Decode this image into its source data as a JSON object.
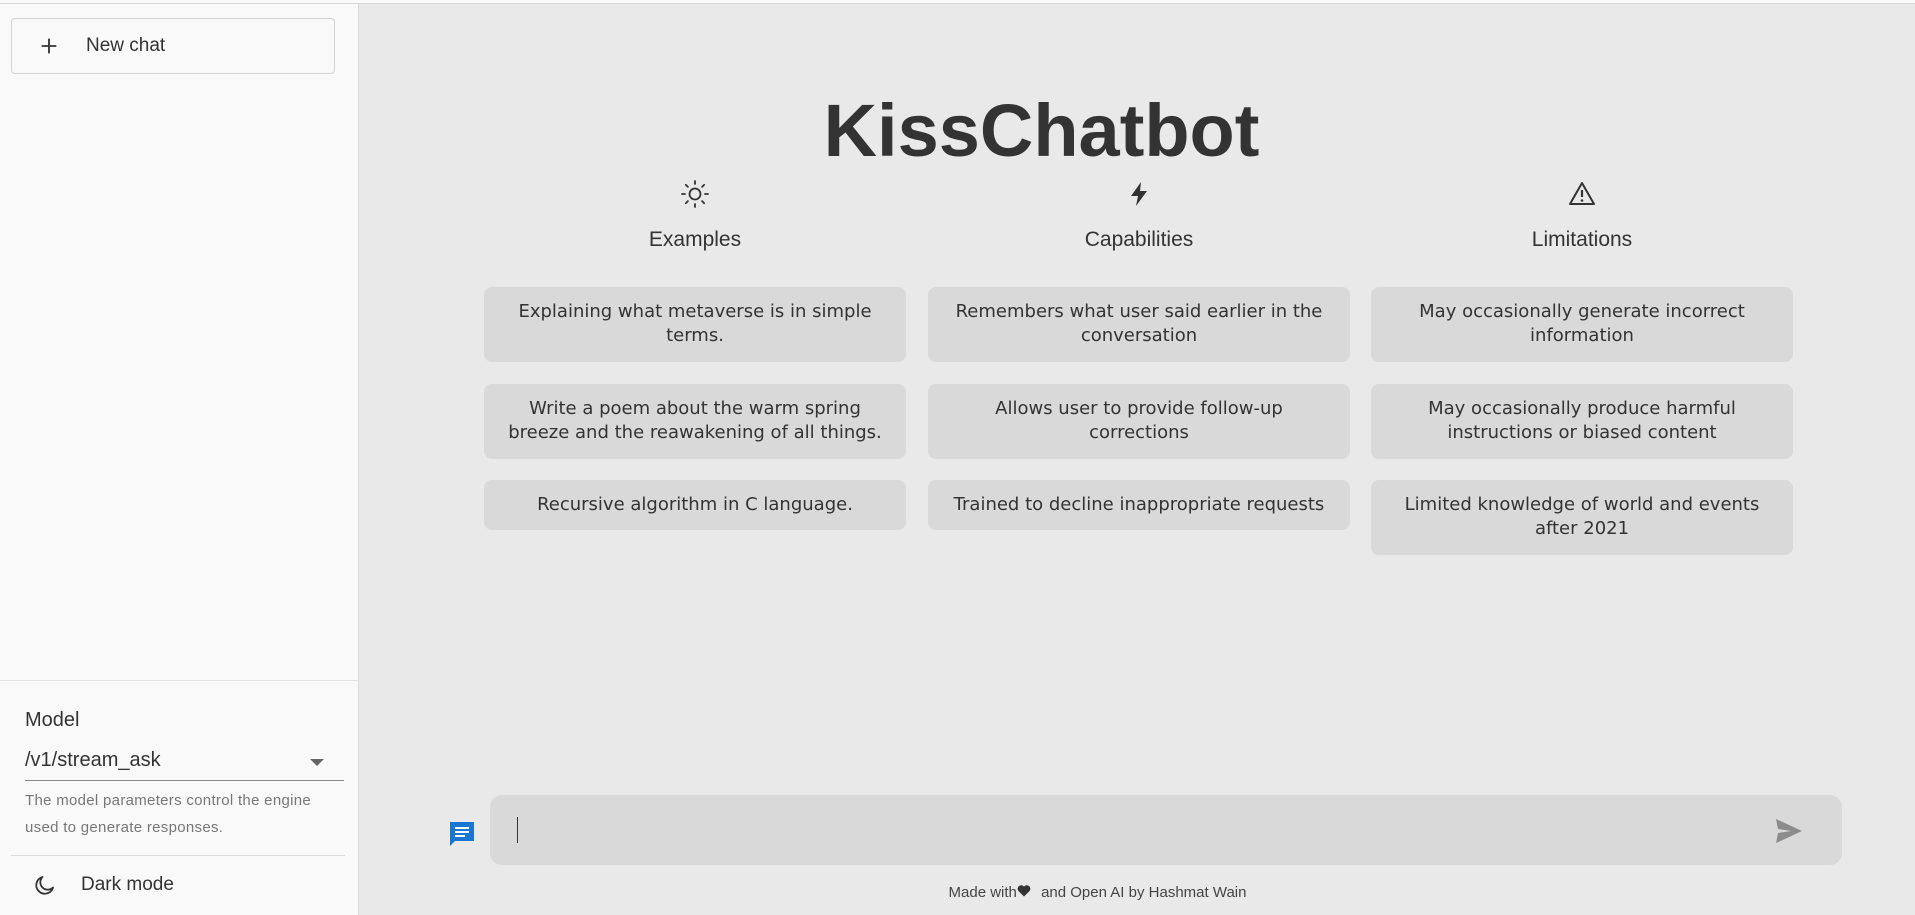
{
  "sidebar": {
    "new_chat_label": "New chat",
    "model_label": "Model",
    "model_value": "/v1/stream_ask",
    "model_help": "The model parameters control the engine used to generate responses.",
    "dark_mode_label": "Dark mode"
  },
  "main": {
    "title": "KissChatbot",
    "columns": [
      {
        "icon": "sun-icon",
        "heading": "Examples",
        "cards": [
          "Explaining what metaverse is in simple terms.",
          "Write a poem about the warm spring breeze and the reawakening of all things.",
          "Recursive algorithm in C language."
        ]
      },
      {
        "icon": "lightning-icon",
        "heading": "Capabilities",
        "cards": [
          "Remembers what user said earlier in the conversation",
          "Allows user to provide follow-up corrections",
          "Trained to decline inappropriate requests"
        ]
      },
      {
        "icon": "warning-icon",
        "heading": "Limitations",
        "cards": [
          "May occasionally generate incorrect information",
          "May occasionally produce harmful instructions or biased content",
          "Limited knowledge of world and events after 2021"
        ]
      }
    ],
    "input": {
      "value": "",
      "placeholder": ""
    },
    "footer": {
      "prefix": "Made with",
      "suffix": " and Open AI by Hashmat Wain"
    }
  },
  "colors": {
    "accent": "#1976d2",
    "card_bg": "#d9d9d9",
    "page_bg": "#e9e9e9",
    "sidebar_bg": "#f9f9f9"
  }
}
